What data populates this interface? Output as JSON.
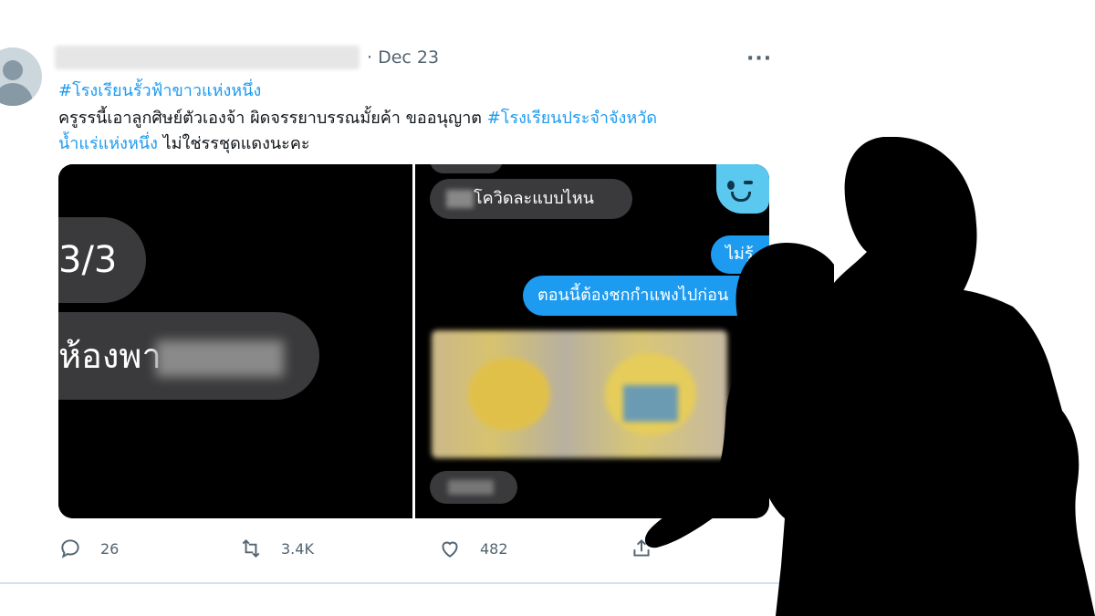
{
  "tweet": {
    "date": "· Dec 23",
    "more": "···",
    "line1_hashtag": "#โรงเรียนรั้วฟ้าขาวแห่งหนึ่ง",
    "line2_text": "ครูรรนี้เอาลูกศิษย์ตัวเองจ้า ผิดจรรยาบรรณมั้ยค้า ขออนุญาต ",
    "line2_hashtag": "#โรงเรียนประจำจังหวัด",
    "line3_hashtag": "น้ำแร่แห่งหนึ่ง",
    "line3_text": " ไม่ใช่รรชุดแดงนะคะ"
  },
  "media": {
    "left": {
      "bubble1": "3/3",
      "bubble2": "ห้องพา"
    },
    "right": {
      "bubble_gray": "โควิดละแบบไหน",
      "bubble_blue1": "ไม่รู้",
      "bubble_blue2": "ตอนนี้ต้องชกกำแพงไปก่อน",
      "scroll_arrow": "‹"
    }
  },
  "actions": {
    "reply_count": "26",
    "retweet_count": "3.4K",
    "like_count": "482"
  },
  "colors": {
    "accent": "#1d9bf0",
    "text": "#0f1419",
    "muted": "#536471"
  }
}
